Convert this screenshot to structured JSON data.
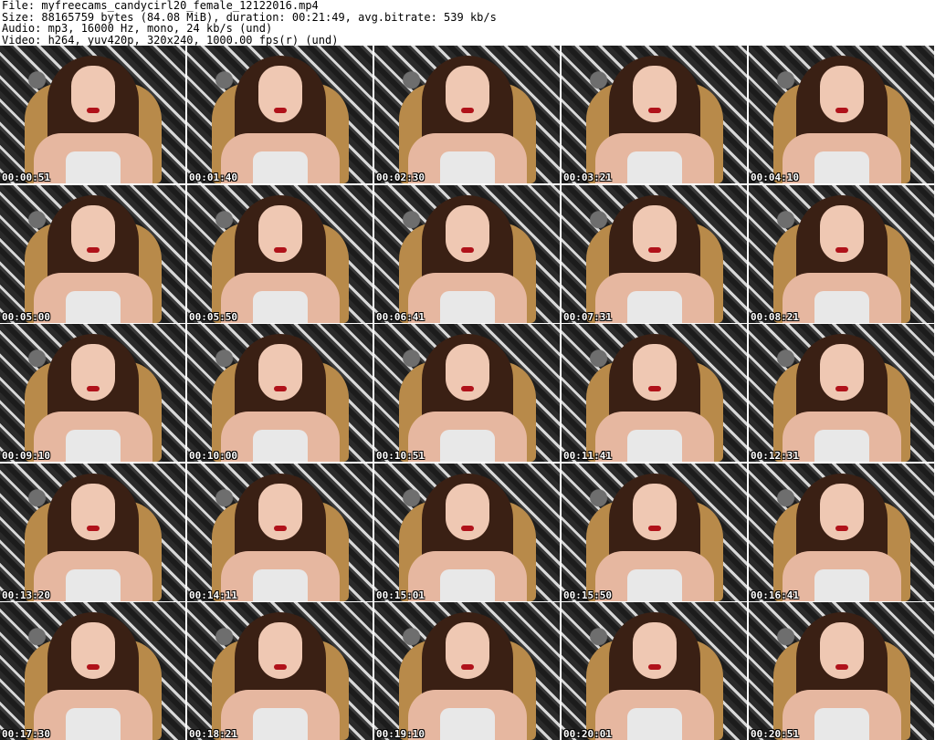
{
  "header": {
    "file_line": "File: myfreecams_candycirl20_female_12122016.mp4",
    "size_line": "Size: 88165759 bytes (84.08 MiB), duration: 00:21:49, avg.bitrate: 539 kb/s",
    "audio_line": "Audio: mp3, 16000 Hz, mono, 24 kb/s (und)",
    "video_line": "Video: h264, yuv420p, 320x240, 1000.00 fps(r) (und)"
  },
  "thumbnails": [
    "00:00:51",
    "00:01:40",
    "00:02:30",
    "00:03:21",
    "00:04:10",
    "00:05:00",
    "00:05:50",
    "00:06:41",
    "00:07:31",
    "00:08:21",
    "00:09:10",
    "00:10:00",
    "00:10:51",
    "00:11:41",
    "00:12:31",
    "00:13:20",
    "00:14:11",
    "00:15:01",
    "00:15:50",
    "00:16:41",
    "00:17:30",
    "00:18:21",
    "00:19:10",
    "00:20:01",
    "00:20:51"
  ]
}
